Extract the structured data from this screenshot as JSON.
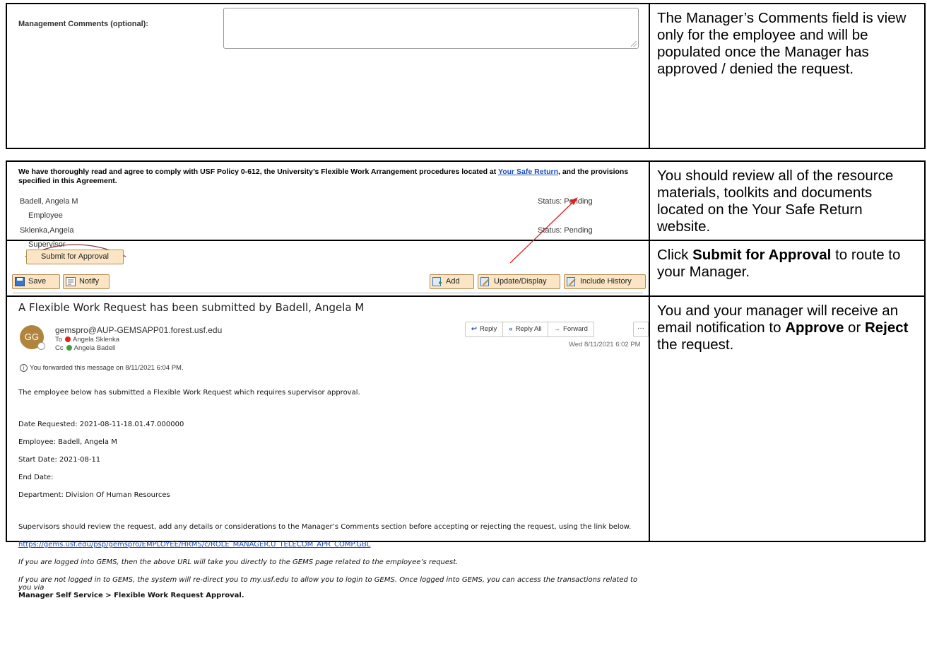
{
  "section1": {
    "label": "Management Comments (optional):",
    "note": "The Manager’s Comments field is view only for the employee and will be populated once the Manager has approved / denied the request."
  },
  "section2": {
    "agreement_prefix": "We have thoroughly read and agree to comply with USF Policy 0-612, the University’s Flexible Work Arrangement procedures located at ",
    "agreement_link": "Your Safe Return",
    "agreement_suffix": ", and the provisions specified in this Agreement.",
    "signers": [
      {
        "name": "Badell, Angela M",
        "role": "Employee",
        "status": "Status: Pending"
      },
      {
        "name": "Sklenka,Angela",
        "role": "Supervisor",
        "status": "Status: Pending"
      }
    ],
    "note": "You should review all of the resource materials, toolkits and documents located on the Your Safe Return website.",
    "submit_button": "Submit for Approval",
    "toolbar": {
      "save": "Save",
      "notify": "Notify",
      "add": "Add",
      "update_display": "Update/Display",
      "include_history": "Include History"
    },
    "note2_prefix": "Click ",
    "note2_bold": "Submit for Approval",
    "note2_suffix": " to route to your Manager."
  },
  "email": {
    "subject": "A Flexible Work Request has been submitted by Badell, Angela M",
    "avatar": "GG",
    "sender": "gemspro@AUP-GEMSAPP01.forest.usf.edu",
    "to_label": "To",
    "to_name": "Angela Sklenka",
    "cc_label": "Cc",
    "cc_name": "Angela Badell",
    "forward_info": "You forwarded this message on 8/11/2021 6:04 PM.",
    "reply": "Reply",
    "reply_all": "Reply All",
    "forward": "Forward",
    "more": "···",
    "date": "Wed 8/11/2021 6:02 PM",
    "body_intro": "The employee below has submitted a Flexible Work Request which requires supervisor approval.",
    "date_requested": "Date Requested: 2021-08-11-18.01.47.000000",
    "employee": "Employee: Badell, Angela M",
    "start_date": "Start Date: 2021-08-11",
    "end_date": "End Date:",
    "department": "Department: Division Of Human Resources",
    "supervisors_note": "Supervisors should review the request, add any details or considerations to the Manager’s Comments section before accepting or rejecting the request, using the link below.",
    "url": "https://gems.usf.edu/psp/gemspro/EMPLOYEE/HRMS/c/ROLE_MANAGER.U_TELECOM_APR_COMP.GBL",
    "logged_in_note": "If you are logged into GEMS, then the above URL will take you directly to the GEMS page related to the employee’s request.",
    "not_logged_note": "If you are not logged in to GEMS, the system will re-direct you to my.usf.edu to allow you to login to GEMS. Once logged into GEMS, you can access the transactions related to you via",
    "path_bold": "Manager Self Service > Flexible Work Request Approval.",
    "note_parts": [
      "You and your manager will receive an email notification to ",
      "Approve",
      " or ",
      "Reject",
      " the request."
    ]
  }
}
